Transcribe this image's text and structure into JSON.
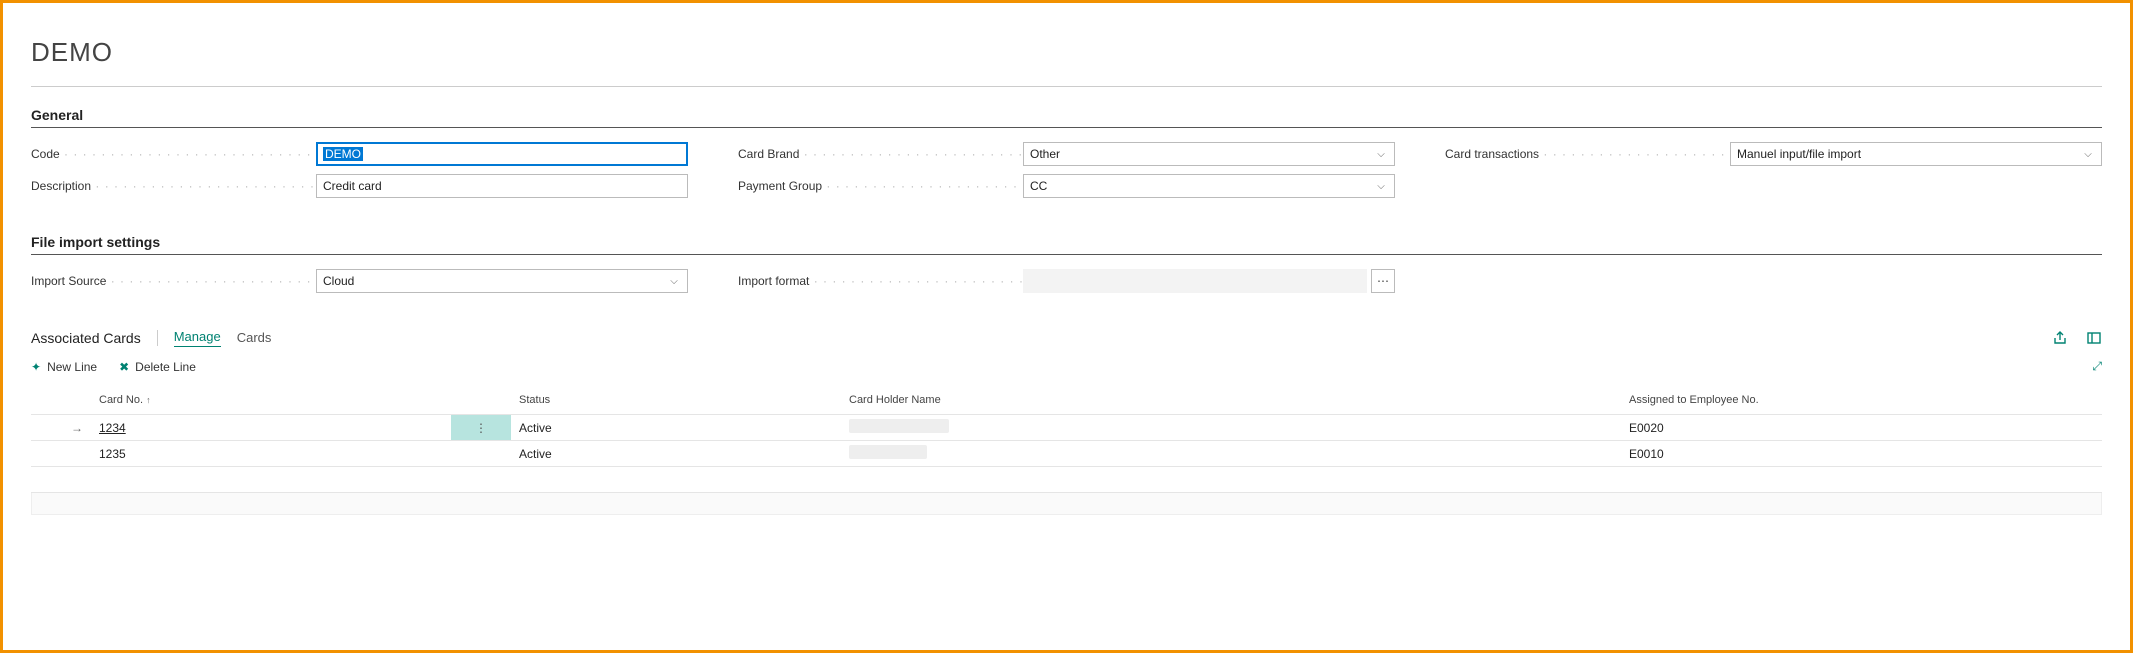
{
  "page": {
    "title": "DEMO"
  },
  "sections": {
    "general": {
      "header": "General",
      "fields": {
        "code": {
          "label": "Code",
          "value": "DEMO"
        },
        "description": {
          "label": "Description",
          "value": "Credit card"
        },
        "card_brand": {
          "label": "Card Brand",
          "value": "Other"
        },
        "payment_group": {
          "label": "Payment Group",
          "value": "CC"
        },
        "card_transactions": {
          "label": "Card transactions",
          "value": "Manuel input/file import"
        }
      }
    },
    "file_import": {
      "header": "File import settings",
      "fields": {
        "import_source": {
          "label": "Import Source",
          "value": "Cloud"
        },
        "import_format": {
          "label": "Import format",
          "value": ""
        }
      }
    },
    "associated_cards": {
      "header": "Associated Cards",
      "tabs": {
        "manage": "Manage",
        "cards": "Cards"
      },
      "actions": {
        "new_line": "New Line",
        "delete_line": "Delete Line"
      },
      "columns": {
        "card_no": "Card No.",
        "status": "Status",
        "card_holder": "Card Holder Name",
        "assigned_emp": "Assigned to Employee No."
      },
      "rows": [
        {
          "card_no": "1234",
          "status": "Active",
          "card_holder": "",
          "assigned_emp": "E0020",
          "selected": true
        },
        {
          "card_no": "1235",
          "status": "Active",
          "card_holder": "",
          "assigned_emp": "E0010",
          "selected": false
        }
      ]
    }
  }
}
